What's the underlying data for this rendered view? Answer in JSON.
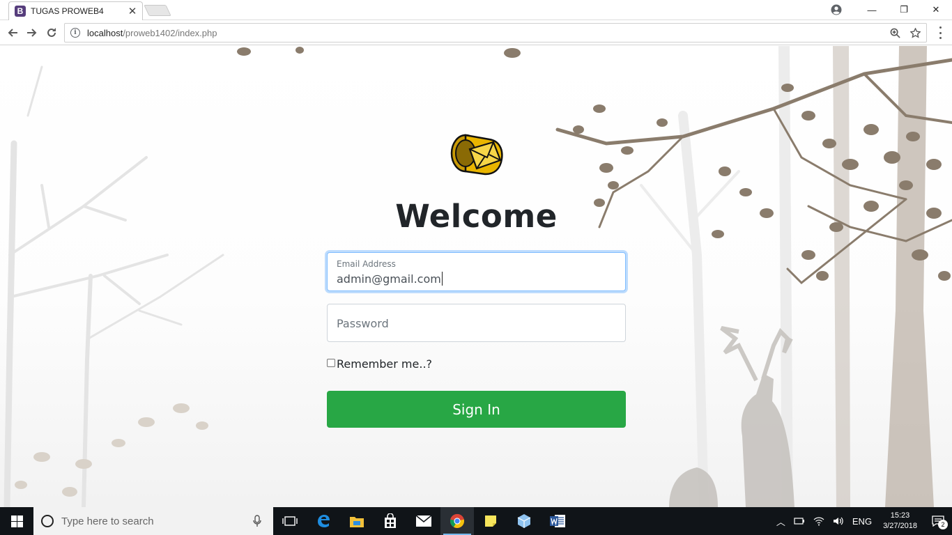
{
  "browser": {
    "tab": {
      "favicon_letter": "B",
      "title": "TUGAS PROWEB4",
      "close": "✕"
    },
    "url": {
      "host": "localhost",
      "path": "/proweb1402/index.php"
    },
    "window_controls": {
      "minimize": "—",
      "restore": "❐",
      "close": "✕"
    }
  },
  "login": {
    "heading": "Welcome",
    "email": {
      "label": "Email Address",
      "value": "admin@gmail.com"
    },
    "password": {
      "placeholder": "Password"
    },
    "remember": {
      "label": "Remember me..?",
      "checked": false
    },
    "submit_label": "Sign In",
    "accent_color": "#28a745"
  },
  "taskbar": {
    "search_placeholder": "Type here to search",
    "apps": [
      "task-view",
      "edge",
      "file-explorer",
      "store",
      "mail",
      "chrome",
      "sticky-notes",
      "app-box",
      "word"
    ],
    "tray": {
      "language": "ENG",
      "time": "15:23",
      "date": "3/27/2018",
      "notification_count": "2"
    }
  }
}
